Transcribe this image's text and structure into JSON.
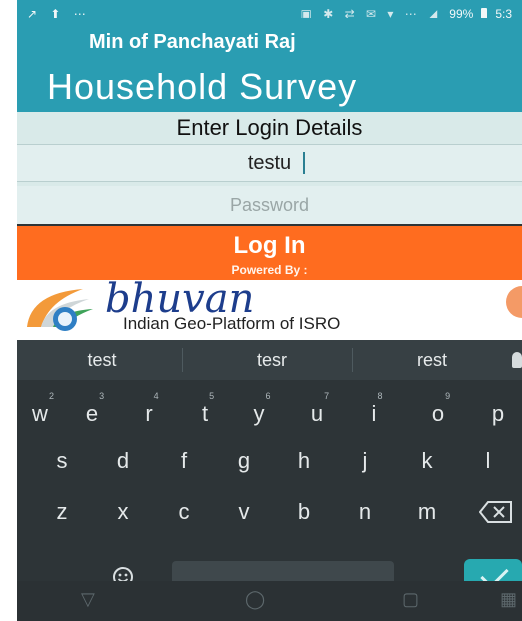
{
  "status_bar": {
    "left_icons": "↗ ⬆ ⋯",
    "right_icons": "▣ ✱ ⇄ ✉ ▾ ⋯ ◢",
    "battery_text": "99%",
    "time": "5:3"
  },
  "app": {
    "ministry": "Min of Panchayati Raj",
    "title": "Household Survey"
  },
  "login": {
    "heading": "Enter Login Details",
    "username_value": "testu",
    "password_placeholder": "Password",
    "button_label": "Log In",
    "powered_by": "Powered By :"
  },
  "branding": {
    "name": "bhuvan",
    "tagline": "Indian Geo-Platform of ISRO"
  },
  "keyboard": {
    "suggestions": [
      "test",
      "tesr",
      "rest"
    ],
    "row1": [
      {
        "k": "w",
        "s": "2"
      },
      {
        "k": "e",
        "s": "3"
      },
      {
        "k": "r",
        "s": "4"
      },
      {
        "k": "t",
        "s": "5"
      },
      {
        "k": "y",
        "s": "6"
      },
      {
        "k": "u",
        "s": "7"
      },
      {
        "k": "i",
        "s": "8"
      },
      {
        "k": "o",
        "s": "9"
      },
      {
        "k": "p",
        "s": ""
      }
    ],
    "row2": [
      "s",
      "d",
      "f",
      "g",
      "h",
      "j",
      "k",
      "l"
    ],
    "row3": [
      "z",
      "x",
      "c",
      "v",
      "b",
      "n",
      "m"
    ],
    "comma": ",",
    "period": "."
  },
  "colors": {
    "header": "#2a9db2",
    "login_button": "#ff6c1f",
    "brand": "#1d3d8c",
    "enter_key": "#27a9b0"
  }
}
